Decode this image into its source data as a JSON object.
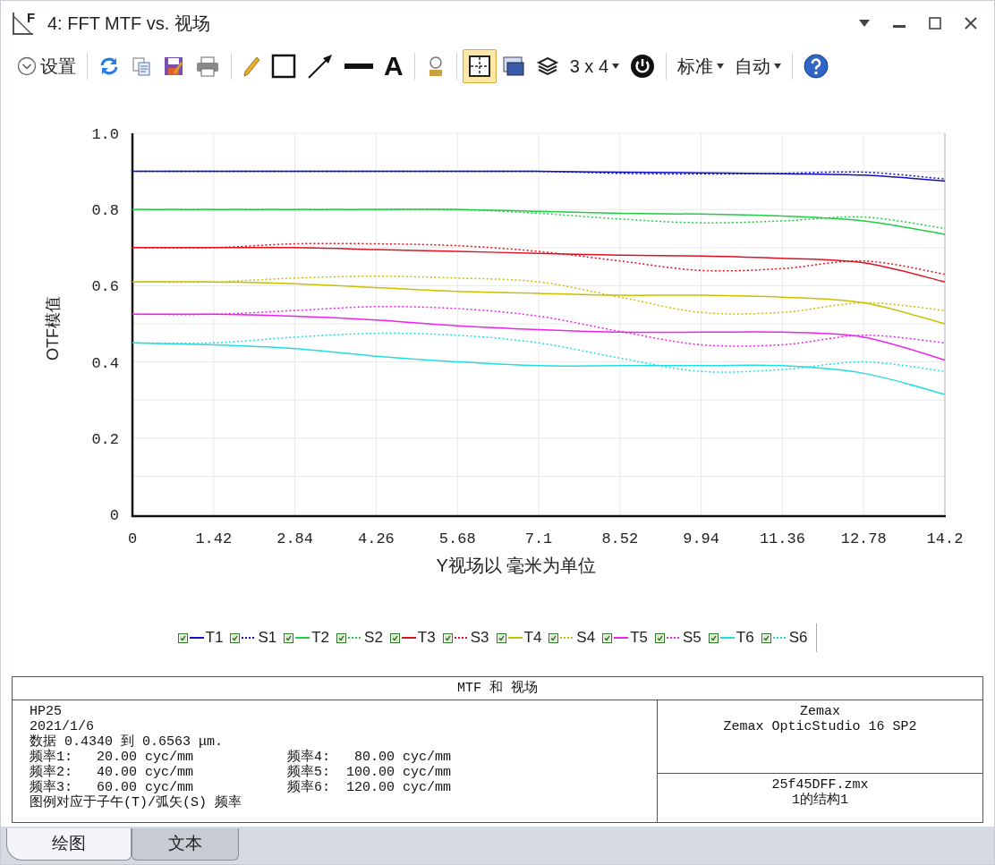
{
  "window": {
    "icon_letter": "F",
    "title": "4: FFT MTF vs. 视场"
  },
  "toolbar": {
    "groups": [
      [
        {
          "kind": "settings",
          "label": "设置",
          "selected": false
        }
      ],
      [
        {
          "kind": "refresh",
          "selected": false
        },
        {
          "kind": "copy",
          "selected": false
        },
        {
          "kind": "save",
          "selected": false
        },
        {
          "kind": "print",
          "selected": false
        }
      ],
      [
        {
          "kind": "pencil",
          "selected": false
        },
        {
          "kind": "rectangle",
          "selected": false
        },
        {
          "kind": "arrow",
          "selected": false
        },
        {
          "kind": "line",
          "selected": false
        },
        {
          "kind": "letter",
          "label": "A",
          "selected": false
        }
      ],
      [
        {
          "kind": "lamp",
          "selected": false
        }
      ],
      [
        {
          "kind": "grid",
          "selected": true
        },
        {
          "kind": "window",
          "selected": false
        },
        {
          "kind": "layers",
          "selected": false
        },
        {
          "kind": "dropdown",
          "label": "3 x 4",
          "selected": false
        },
        {
          "kind": "power",
          "selected": false
        }
      ],
      [
        {
          "kind": "dropdown",
          "label": "标准",
          "selected": false
        },
        {
          "kind": "dropdown",
          "label": "自动",
          "selected": false
        }
      ],
      [
        {
          "kind": "help",
          "selected": false
        }
      ]
    ]
  },
  "chart": {
    "chart_data": {
      "type": "line",
      "xlabel": "Y视场以 毫米为单位",
      "ylabel": "OTF模值",
      "x": [
        0,
        1.42,
        2.84,
        4.26,
        5.68,
        7.1,
        8.52,
        9.94,
        11.36,
        12.78,
        14.2
      ],
      "xlim": [
        0,
        14.2
      ],
      "ylim": [
        0,
        1
      ],
      "grid": true,
      "xticks": [
        {
          "value": 0,
          "label": "0"
        },
        {
          "value": 1.42,
          "label": "1.42"
        },
        {
          "value": 2.84,
          "label": "2.84"
        },
        {
          "value": 4.26,
          "label": "4.26"
        },
        {
          "value": 5.68,
          "label": "5.68"
        },
        {
          "value": 7.1,
          "label": "7.1"
        },
        {
          "value": 8.52,
          "label": "8.52"
        },
        {
          "value": 9.94,
          "label": "9.94"
        },
        {
          "value": 11.36,
          "label": "11.36"
        },
        {
          "value": 12.78,
          "label": "12.78"
        },
        {
          "value": 14.2,
          "label": "14.2"
        }
      ],
      "yticks": [
        {
          "value": 0,
          "label": "0"
        },
        {
          "value": 0.2,
          "label": "0.2"
        },
        {
          "value": 0.4,
          "label": "0.4"
        },
        {
          "value": 0.6,
          "label": "0.6"
        },
        {
          "value": 0.8,
          "label": "0.8"
        },
        {
          "value": 1,
          "label": "1.0"
        }
      ],
      "series": [
        {
          "name": "T1",
          "color": "#1010c0",
          "line_style": "solid",
          "values": [
            0.9,
            0.9,
            0.9,
            0.9,
            0.9,
            0.9,
            0.898,
            0.896,
            0.894,
            0.89,
            0.875
          ]
        },
        {
          "name": "S1",
          "color": "#1010c0",
          "line_style": "dotted",
          "values": [
            0.9,
            0.9,
            0.9,
            0.9,
            0.9,
            0.9,
            0.895,
            0.893,
            0.895,
            0.898,
            0.88
          ]
        },
        {
          "name": "T2",
          "color": "#22cc44",
          "line_style": "solid",
          "values": [
            0.8,
            0.8,
            0.8,
            0.8,
            0.8,
            0.795,
            0.79,
            0.788,
            0.783,
            0.77,
            0.735
          ]
        },
        {
          "name": "S2",
          "color": "#22cc44",
          "line_style": "dotted",
          "values": [
            0.8,
            0.8,
            0.8,
            0.8,
            0.8,
            0.79,
            0.775,
            0.765,
            0.77,
            0.78,
            0.75
          ]
        },
        {
          "name": "T3",
          "color": "#e01020",
          "line_style": "solid",
          "values": [
            0.7,
            0.7,
            0.7,
            0.695,
            0.69,
            0.685,
            0.68,
            0.678,
            0.672,
            0.66,
            0.61
          ]
        },
        {
          "name": "S3",
          "color": "#e01020",
          "line_style": "dotted",
          "values": [
            0.7,
            0.7,
            0.71,
            0.71,
            0.705,
            0.69,
            0.665,
            0.64,
            0.645,
            0.665,
            0.63
          ]
        },
        {
          "name": "T4",
          "color": "#c8c000",
          "line_style": "solid",
          "values": [
            0.61,
            0.61,
            0.605,
            0.595,
            0.585,
            0.58,
            0.575,
            0.575,
            0.57,
            0.555,
            0.5
          ]
        },
        {
          "name": "S4",
          "color": "#c8c000",
          "line_style": "dotted",
          "values": [
            0.61,
            0.61,
            0.62,
            0.625,
            0.62,
            0.61,
            0.57,
            0.53,
            0.53,
            0.555,
            0.535
          ]
        },
        {
          "name": "T5",
          "color": "#ee22ee",
          "line_style": "solid",
          "values": [
            0.525,
            0.525,
            0.52,
            0.51,
            0.495,
            0.485,
            0.478,
            0.478,
            0.478,
            0.465,
            0.405
          ]
        },
        {
          "name": "S5",
          "color": "#ee22ee",
          "line_style": "dotted",
          "values": [
            0.525,
            0.525,
            0.535,
            0.545,
            0.54,
            0.52,
            0.48,
            0.445,
            0.445,
            0.47,
            0.45
          ]
        },
        {
          "name": "T6",
          "color": "#22dddd",
          "line_style": "solid",
          "values": [
            0.45,
            0.445,
            0.435,
            0.415,
            0.4,
            0.39,
            0.39,
            0.39,
            0.39,
            0.37,
            0.315
          ]
        },
        {
          "name": "S6",
          "color": "#22dddd",
          "line_style": "dotted",
          "values": [
            0.45,
            0.45,
            0.465,
            0.475,
            0.47,
            0.45,
            0.41,
            0.375,
            0.38,
            0.4,
            0.375
          ]
        }
      ]
    },
    "legend": [
      {
        "checked": true
      },
      {
        "checked": true
      },
      {
        "checked": true
      },
      {
        "checked": true
      },
      {
        "checked": true
      },
      {
        "checked": true
      },
      {
        "checked": true
      },
      {
        "checked": true
      },
      {
        "checked": true
      },
      {
        "checked": true
      },
      {
        "checked": true
      },
      {
        "checked": true
      }
    ]
  },
  "info": {
    "title": "MTF 和 视场",
    "lines": [
      "HP25",
      "2021/1/6",
      "数据 0.4340 到 0.6563 μm."
    ],
    "frequencies": [
      [
        "频率1:   20.00 cyc/mm",
        "频率4:   80.00 cyc/mm"
      ],
      [
        "频率2:   40.00 cyc/mm",
        "频率5:  100.00 cyc/mm"
      ],
      [
        "频率3:   60.00 cyc/mm",
        "频率6:  120.00 cyc/mm"
      ]
    ],
    "note": "图例对应于子午(T)/弧矢(S) 频率",
    "software": [
      "Zemax",
      "Zemax OpticStudio 16 SP2"
    ],
    "file": [
      "25f45DFF.zmx",
      "1的结构1"
    ]
  },
  "tabs": [
    {
      "label": "绘图",
      "selected": true
    },
    {
      "label": "文本",
      "selected": false
    }
  ]
}
